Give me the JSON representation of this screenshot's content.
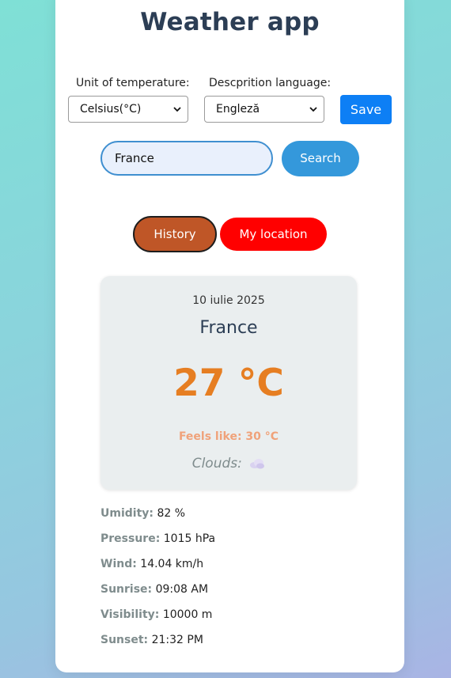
{
  "app": {
    "title": "Weather app"
  },
  "settings": {
    "unit_label": "Unit of temperature:",
    "unit_value": "Celsius(°C)",
    "language_label": "Descprition language:",
    "language_value": "Engleză",
    "save_label": "Save"
  },
  "search": {
    "value": "France",
    "button_label": "Search"
  },
  "actions": {
    "history_label": "History",
    "location_label": "My location"
  },
  "weather": {
    "date": "10 iulie 2025",
    "city": "France",
    "temperature": "27 °C",
    "feels_like": "Feels like: 30 °C",
    "condition": "Clouds:",
    "condition_icon": "cloud-icon"
  },
  "details": [
    {
      "label": "Umidity:",
      "value": "82 %"
    },
    {
      "label": "Pressure:",
      "value": "1015 hPa"
    },
    {
      "label": "Wind:",
      "value": "14.04 km/h"
    },
    {
      "label": "Sunrise:",
      "value": "09:08 AM"
    },
    {
      "label": "Visibility:",
      "value": "10000 m"
    },
    {
      "label": "Sunset:",
      "value": "21:32 PM"
    }
  ],
  "colors": {
    "save": "#0d7ff5",
    "search": "#3498db",
    "history": "#bf5627",
    "location": "#ff0000",
    "temperature": "#e67e22",
    "feels_like": "#f0a27a"
  }
}
